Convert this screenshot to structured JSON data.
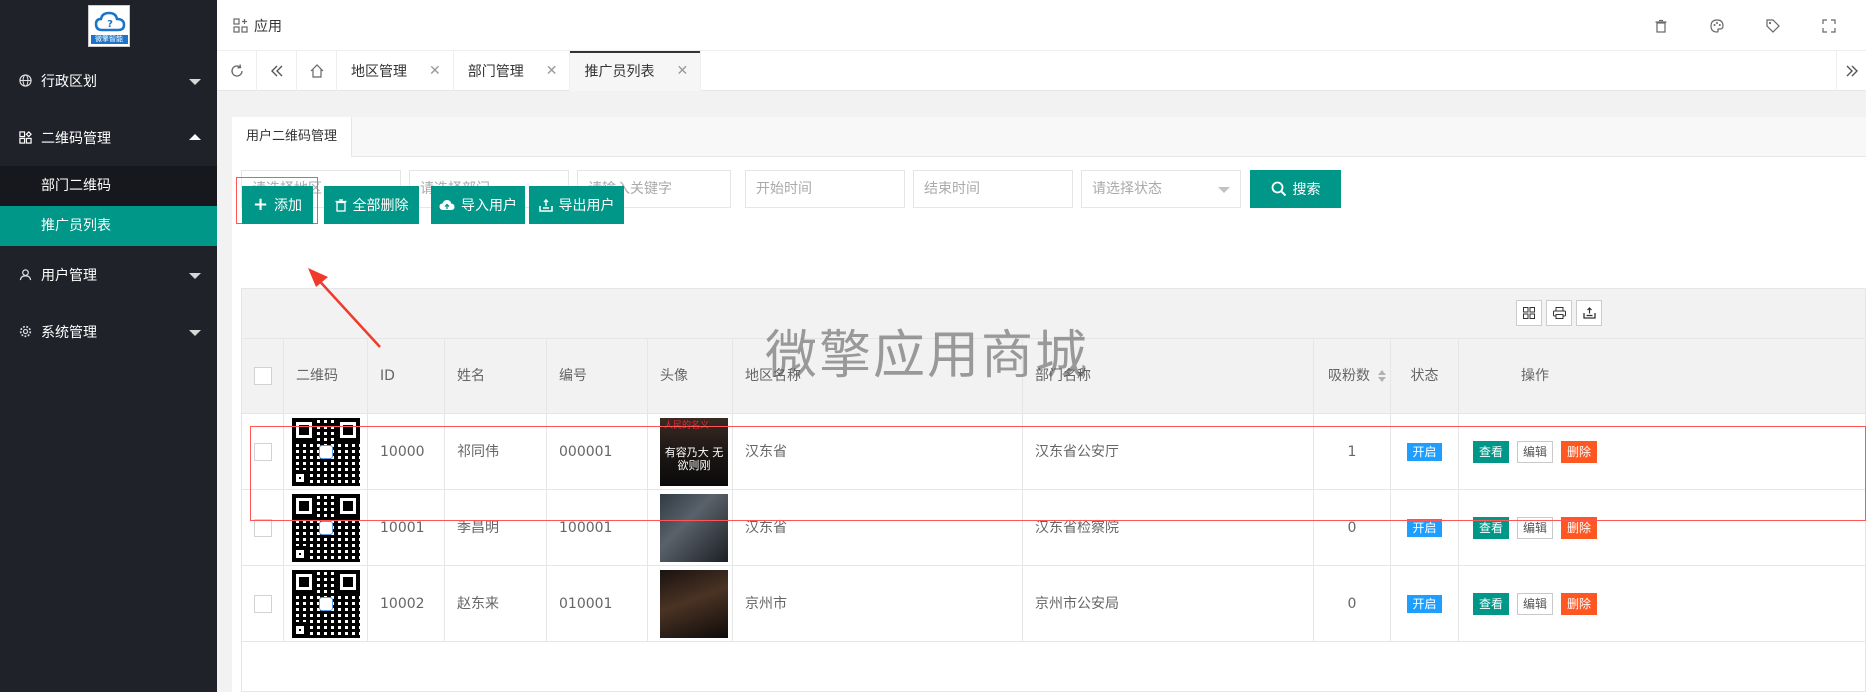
{
  "sidebar": {
    "logo_text": "微擎智能",
    "items": [
      {
        "label": "行政区划",
        "icon": "globe-icon",
        "expanded": false
      },
      {
        "label": "二维码管理",
        "icon": "qrcode-icon",
        "expanded": true,
        "children": [
          {
            "label": "部门二维码",
            "active": false
          },
          {
            "label": "推广员列表",
            "active": true
          }
        ]
      },
      {
        "label": "用户管理",
        "icon": "user-icon",
        "expanded": false
      },
      {
        "label": "系统管理",
        "icon": "gear-icon",
        "expanded": false
      }
    ]
  },
  "topbar": {
    "app_label": "应用",
    "icons": [
      "trash-icon",
      "palette-icon",
      "tag-icon",
      "fullscreen-icon"
    ]
  },
  "tabs": [
    {
      "label": "地区管理",
      "active": false
    },
    {
      "label": "部门管理",
      "active": false
    },
    {
      "label": "推广员列表",
      "active": true
    }
  ],
  "card": {
    "tab_label": "用户二维码管理"
  },
  "filters": {
    "region_placeholder": "请选择地区",
    "dept_placeholder": "请选择部门",
    "keyword_placeholder": "请输入关键字",
    "start_placeholder": "开始时间",
    "end_placeholder": "结束时间",
    "status_placeholder": "请选择状态",
    "search_label": "搜索"
  },
  "actions": {
    "add_label": "添加",
    "delete_all_label": "全部删除",
    "import_label": "导入用户",
    "export_label": "导出用户"
  },
  "watermark": "微擎应用商城",
  "table": {
    "headers": {
      "qrcode": "二维码",
      "id": "ID",
      "name": "姓名",
      "code": "编号",
      "avatar": "头像",
      "region": "地区名称",
      "dept": "部门名称",
      "fans": "吸粉数",
      "status": "状态",
      "ops": "操作"
    },
    "rows": [
      {
        "id": "10000",
        "name": "祁同伟",
        "code": "000001",
        "region": "汉东省",
        "dept": "汉东省公安厅",
        "fans": "1",
        "status": "开启",
        "avatar_caption": "有容乃大 无欲则刚",
        "avatar_title": "人民的名义"
      },
      {
        "id": "10001",
        "name": "季昌明",
        "code": "100001",
        "region": "汉东省",
        "dept": "汉东省检察院",
        "fans": "0",
        "status": "开启",
        "avatar_caption": "",
        "avatar_title": ""
      },
      {
        "id": "10002",
        "name": "赵东来",
        "code": "010001",
        "region": "京州市",
        "dept": "京州市公安局",
        "fans": "0",
        "status": "开启",
        "avatar_caption": "",
        "avatar_title": ""
      }
    ],
    "op_labels": {
      "view": "查看",
      "edit": "编辑",
      "delete": "删除"
    }
  },
  "colors": {
    "sidebar_bg": "#20222a",
    "primary": "#009688",
    "status_blue": "#1e9fff",
    "danger": "#ff5722",
    "highlight": "#ff5555"
  }
}
